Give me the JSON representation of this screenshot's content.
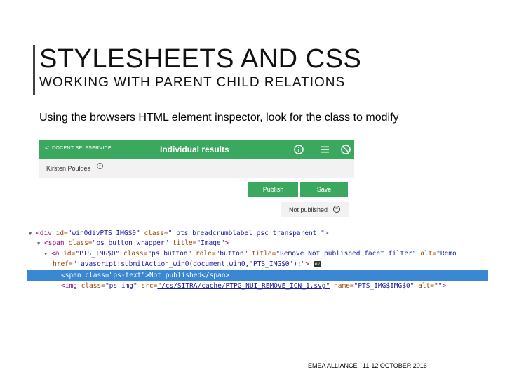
{
  "slide": {
    "title": "STYLESHEETS AND CSS",
    "subtitle": "WORKING WITH PARENT CHILD RELATIONS",
    "body": "Using the browsers HTML element inspector, look for the class to modify",
    "footer": "EMEA ALLIANCE   11-12 OCTOBER 2016"
  },
  "app": {
    "back_chevron": "<",
    "back_label": "DOCENT SELFSERVICE",
    "page_heading": "Individual results",
    "header_icons": [
      "info-icon",
      "menu-icon",
      "no-entry-icon"
    ],
    "user_name": "Kirsten Pouldes",
    "user_caret": "⌄",
    "publish_label": "Publish",
    "save_label": "Save",
    "filter_label": "Not published",
    "filter_remove": "×",
    "accent_color": "#3aa85e"
  },
  "inspector": {
    "line1": {
      "open": "<div ",
      "a1": "id=",
      "v1": "\"win0divPTS_IMG$0\"",
      "a2": " class=",
      "v2": "\" pts_breadcrumblabel psc_transparent \"",
      "close": ">"
    },
    "line2": {
      "open": "<span ",
      "a1": "class=",
      "v1": "\"ps button wrapper\"",
      "a2": " title=",
      "v2": "\"Image\"",
      "close": ">"
    },
    "line3": {
      "open": "<a ",
      "a1": "id=",
      "v1": "\"PTS_IMG$0\"",
      "a2": " class=",
      "v2": "\"ps button\"",
      "a3": " role=",
      "v3": "\"button\"",
      "a4": " title=",
      "v4": "\"Remove Not published facet filter\"",
      "a5": " alt=",
      "v5": "\"Remo"
    },
    "line4": {
      "a1": "href=",
      "v1": "\"javascript:submitAction_win0(document.win0,'PTS_IMG$0');\"",
      "close": ">",
      "badge": "ev"
    },
    "line5": {
      "text": "<span class=\"ps-text\">Not published</span>"
    },
    "line6": {
      "open": "<img ",
      "a1": "class=",
      "v1": "\"ps img\"",
      "a2": " src=",
      "v2": "\"/cs/SITRA/cache/PTPG_NUI_REMOVE_ICN_1.svg\"",
      "a3": " name=",
      "v3": "\"PTS_IMG$IMG$0\"",
      "a4": " alt=",
      "v4": "\"\"",
      "close": ">"
    }
  }
}
